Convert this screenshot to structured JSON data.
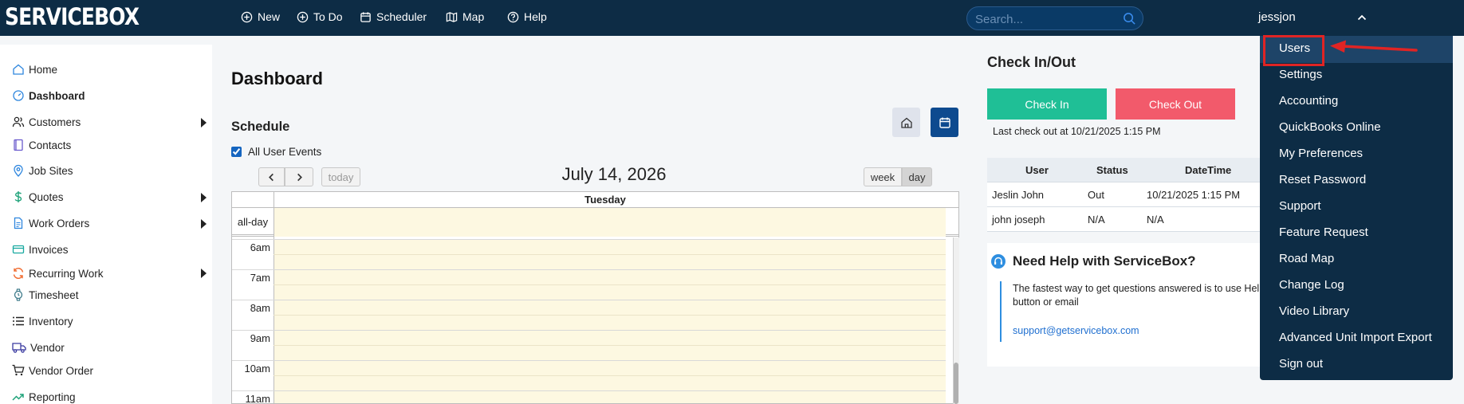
{
  "topbar": {
    "logo": "SERVICEBOX",
    "nav": [
      {
        "label": "New",
        "icon": "plus-circle-icon"
      },
      {
        "label": "To Do",
        "icon": "plus-circle-icon"
      },
      {
        "label": "Scheduler",
        "icon": "calendar-icon"
      },
      {
        "label": "Map",
        "icon": "map-icon"
      },
      {
        "label": "Help",
        "icon": "question-circle-icon"
      }
    ],
    "search_placeholder": "Search...",
    "username": "jessjon"
  },
  "sidebar": {
    "items": [
      {
        "label": "Home",
        "icon": "home-icon"
      },
      {
        "label": "Dashboard",
        "icon": "gauge-icon"
      },
      {
        "label": "Customers",
        "icon": "users-icon"
      },
      {
        "label": "Contacts",
        "icon": "book-icon"
      },
      {
        "label": "Job Sites",
        "icon": "location-pin-icon"
      },
      {
        "label": "Quotes",
        "icon": "dollar-icon"
      },
      {
        "label": "Work Orders",
        "icon": "document-icon"
      },
      {
        "label": "Invoices",
        "icon": "credit-card-icon"
      },
      {
        "label": "Recurring Work",
        "icon": "refresh-icon"
      },
      {
        "label": "Timesheet",
        "icon": "watch-icon"
      },
      {
        "label": "Inventory",
        "icon": "list-icon"
      },
      {
        "label": "Vendor",
        "icon": "truck-icon"
      },
      {
        "label": "Vendor Order",
        "icon": "cart-icon"
      },
      {
        "label": "Reporting",
        "icon": "trend-icon"
      }
    ]
  },
  "dashboard": {
    "title": "Dashboard",
    "schedule_title": "Schedule",
    "all_user_events": "All User Events",
    "calendar": {
      "today_label": "today",
      "week_label": "week",
      "day_label": "day",
      "date": "July 14, 2026",
      "day_header": "Tuesday",
      "allday_label": "all-day",
      "hours": [
        "6am",
        "7am",
        "8am",
        "9am",
        "10am",
        "11am"
      ]
    }
  },
  "checkinout": {
    "title": "Check In/Out",
    "check_in": "Check In",
    "check_out": "Check Out",
    "last_checkout": "Last check out at 10/21/2025 1:15 PM",
    "columns": [
      "User",
      "Status",
      "DateTime"
    ],
    "rows": [
      [
        "Jeslin John",
        "Out",
        "10/21/2025 1:15 PM"
      ],
      [
        "john joseph",
        "N/A",
        "N/A"
      ]
    ]
  },
  "help": {
    "title": "Need Help with ServiceBox?",
    "text": "The fastest way to get questions answered is to use Help button or email",
    "email": "support@getservicebox.com"
  },
  "user_menu": {
    "items": [
      "Users",
      "Settings",
      "Accounting",
      "QuickBooks Online",
      "My Preferences",
      "Reset Password",
      "Support",
      "Feature Request",
      "Road Map",
      "Change Log",
      "Video Library",
      "Advanced Unit Import Export",
      "Sign out"
    ]
  },
  "colors": {
    "topbar": "#0d2c45",
    "check_in": "#1fbf96",
    "check_out": "#f25a6b",
    "calendar_bg": "#fdf8e1",
    "annotation": "#e02424"
  }
}
